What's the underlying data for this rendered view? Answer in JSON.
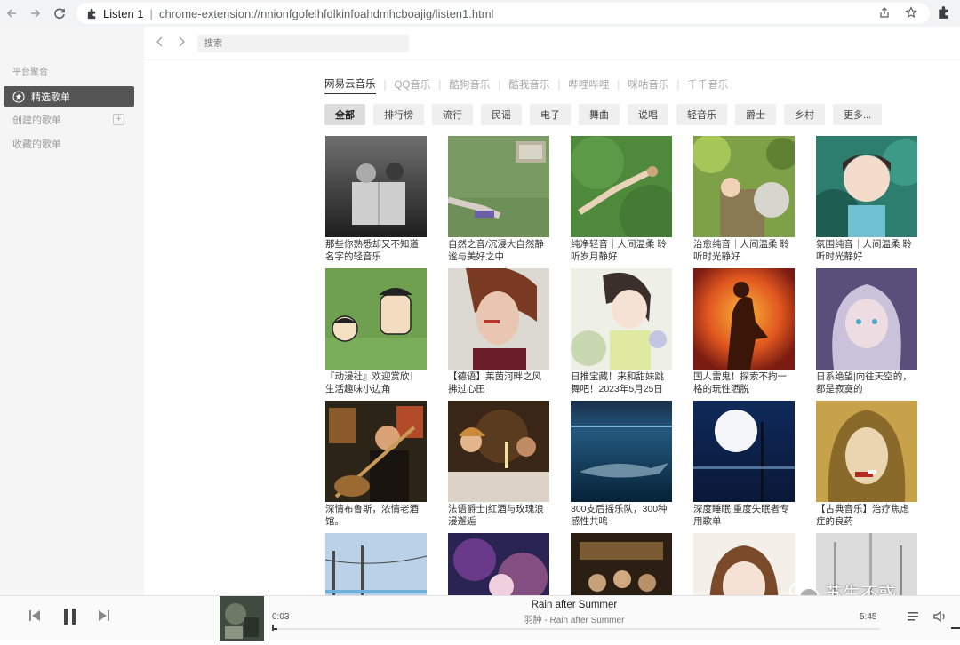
{
  "browser": {
    "tab_title": "Listen 1",
    "url": "chrome-extension://nnionfgofelhfdlkinfoahdmhcboajig/listen1.html"
  },
  "sidebar": {
    "heading": "平台聚合",
    "items": [
      {
        "label": "精选歌单",
        "icon": "star-icon",
        "active": true
      },
      {
        "label": "创建的歌单",
        "icon": "",
        "active": false
      },
      {
        "label": "收藏的歌单",
        "icon": "",
        "active": false
      }
    ]
  },
  "search": {
    "placeholder": "搜索"
  },
  "sources": [
    "网易云音乐",
    "QQ音乐",
    "酷狗音乐",
    "酷我音乐",
    "哔哩哔哩",
    "咪咕音乐",
    "千千音乐"
  ],
  "filters": [
    "全部",
    "排行榜",
    "流行",
    "民谣",
    "电子",
    "舞曲",
    "说唱",
    "轻音乐",
    "爵士",
    "乡村",
    "更多..."
  ],
  "playlists": [
    {
      "caption": "那些你熟悉却又不知道名字的轻音乐"
    },
    {
      "caption": "自然之音/沉浸大自然静谧与美好之中"
    },
    {
      "caption": "纯净轻音｜人间温柔 聆听岁月静好"
    },
    {
      "caption": "治愈纯音｜人间温柔 聆听时光静好"
    },
    {
      "caption": "氛围纯音｜人间温柔 聆听时光静好"
    },
    {
      "caption": "『动漫社』欢迎赏欣！生活趣味小边角"
    },
    {
      "caption": "【德语】莱茵河畔之风拂过心田"
    },
    {
      "caption": "日推宝藏！来和甜妹跳舞吧！2023年5月25日"
    },
    {
      "caption": "国人雷鬼！探索不拘一格的玩性洒脱"
    },
    {
      "caption": "日系绝望|向往天空的，都是寂寞的"
    },
    {
      "caption": "深情布鲁斯，浓情老酒馆。"
    },
    {
      "caption": "法语爵士|红酒与玫瑰浪漫邂逅"
    },
    {
      "caption": "300支后摇乐队，300种感性共鸣"
    },
    {
      "caption": "深度睡眠|重度失眠者专用歌单"
    },
    {
      "caption": "【古典音乐】治疗焦虑症的良药"
    },
    {
      "caption": ""
    },
    {
      "caption": ""
    },
    {
      "caption": ""
    },
    {
      "caption": ""
    },
    {
      "caption": ""
    }
  ],
  "player": {
    "song": "Rain after Summer",
    "artist": "羽肿 - Rain after Summer",
    "current_time": "0:03",
    "total_time": "5:45",
    "progress": 0.009
  },
  "watermark": "苏生不惑"
}
